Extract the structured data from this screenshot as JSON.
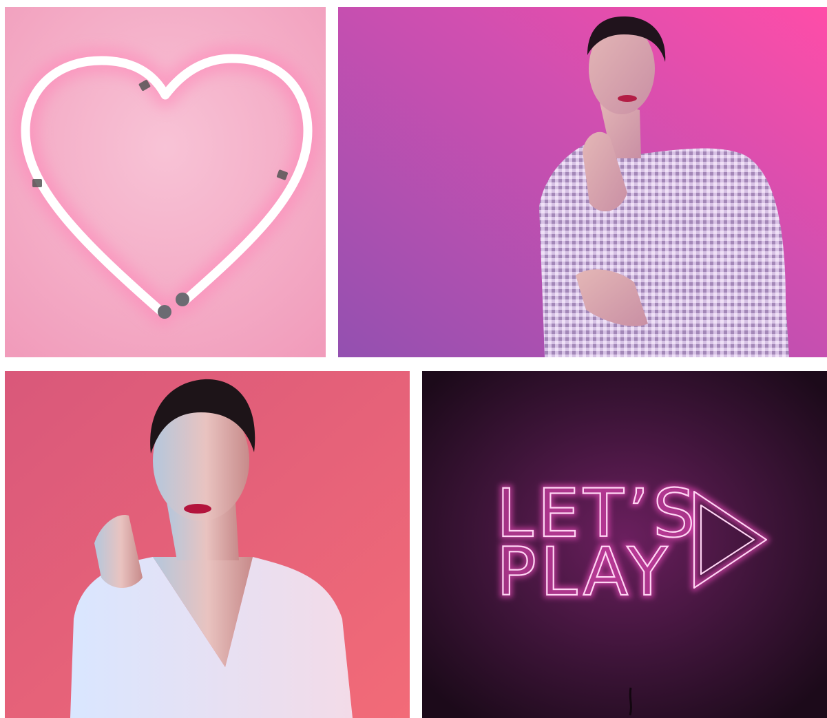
{
  "tiles": [
    {
      "id": "heart",
      "subject": "neon-heart"
    },
    {
      "id": "portrait-sequin",
      "subject": "woman-sequin-jacket"
    },
    {
      "id": "portrait-white",
      "subject": "woman-white-blazer"
    },
    {
      "id": "lets-play",
      "subject": "neon-sign"
    }
  ],
  "neon_sign": {
    "line1": "LET’S",
    "line2": "PLAY",
    "icon": "play-triangle-icon"
  },
  "colors": {
    "heart_bg": "#f4a8c4",
    "sequin_bg_left": "#9b55b8",
    "sequin_bg_right": "#f04fa8",
    "white_blazer_bg": "#e8607c",
    "neon_bg": "#3a1233",
    "neon_stroke": "#ffd6f4",
    "neon_glow": "#ff4fc8"
  }
}
